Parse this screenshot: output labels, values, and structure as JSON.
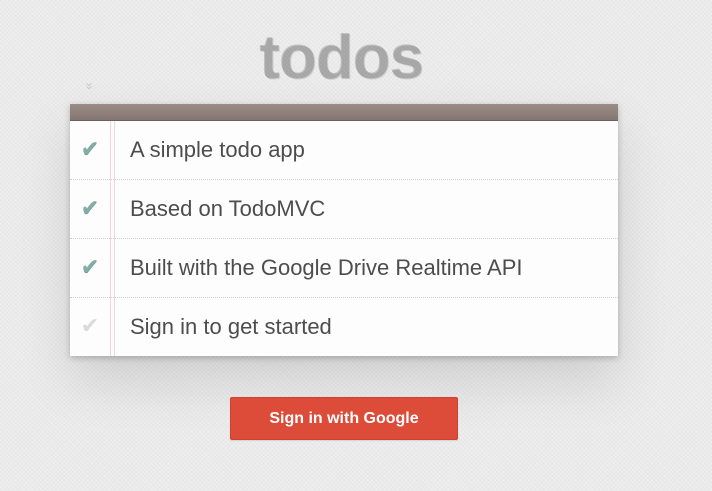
{
  "app": {
    "title": "todos"
  },
  "toggle_all": {
    "glyph": "»",
    "icon": "chevron-double-down-icon"
  },
  "todos": [
    {
      "label": "A simple todo app",
      "completed": true,
      "check_glyph": "✔"
    },
    {
      "label": "Based on TodoMVC",
      "completed": true,
      "check_glyph": "✔"
    },
    {
      "label": "Built with the Google Drive Realtime API",
      "completed": true,
      "check_glyph": "✔"
    },
    {
      "label": "Sign in to get started",
      "completed": false,
      "check_glyph": "✔"
    }
  ],
  "signin": {
    "label": "Sign in with Google"
  },
  "colors": {
    "header_bar": "#8d7d77",
    "check_done": "#85ada7",
    "check_pending": "#dadada",
    "signin_button": "#dd4b39",
    "title": "#d9d9d9"
  }
}
